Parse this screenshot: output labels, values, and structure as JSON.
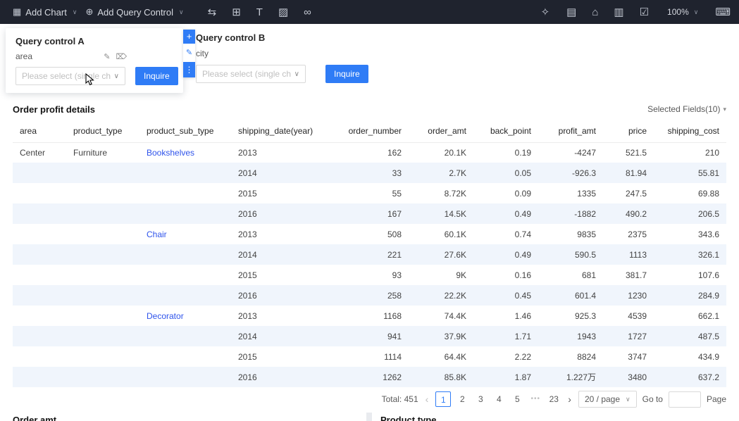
{
  "topbar": {
    "add_chart_label": "Add Chart",
    "add_query_control_label": "Add Query Control",
    "zoom_level": "100%"
  },
  "icons": {
    "add_chart": "▦",
    "add_query_control": "⊕",
    "swap": "⇆",
    "tabs": "⊞",
    "text": "T",
    "image": "▨",
    "link": "∞",
    "theme": "✧",
    "file": "▤",
    "template": "⌂",
    "export": "▥",
    "publish": "☑",
    "keyboard": "⌨",
    "pencil": "✎",
    "trash": "⌦",
    "plus": "+",
    "dots": "⋮",
    "chevron": "∨",
    "caret": "▾",
    "prev": "‹",
    "next": "›"
  },
  "query_controls": {
    "a": {
      "title": "Query control A",
      "field": "area",
      "placeholder": "Please select (single ch...",
      "button": "Inquire"
    },
    "b": {
      "title": "Query control B",
      "field": "city",
      "placeholder": "Please select (single ch...",
      "button": "Inquire"
    }
  },
  "table": {
    "title": "Order profit details",
    "selected_fields": "Selected Fields(10)",
    "headers": [
      "area",
      "product_type",
      "product_sub_type",
      "shipping_date(year)",
      "order_number",
      "order_amt",
      "back_point",
      "profit_amt",
      "price",
      "shipping_cost"
    ],
    "rows": [
      [
        "Center",
        "Furniture",
        "Bookshelves",
        "2013",
        "162",
        "20.1K",
        "0.19",
        "-4247",
        "521.5",
        "210"
      ],
      [
        "",
        "",
        "",
        "2014",
        "33",
        "2.7K",
        "0.05",
        "-926.3",
        "81.94",
        "55.81"
      ],
      [
        "",
        "",
        "",
        "2015",
        "55",
        "8.72K",
        "0.09",
        "1335",
        "247.5",
        "69.88"
      ],
      [
        "",
        "",
        "",
        "2016",
        "167",
        "14.5K",
        "0.49",
        "-1882",
        "490.2",
        "206.5"
      ],
      [
        "",
        "",
        "Chair",
        "2013",
        "508",
        "60.1K",
        "0.74",
        "9835",
        "2375",
        "343.6"
      ],
      [
        "",
        "",
        "",
        "2014",
        "221",
        "27.6K",
        "0.49",
        "590.5",
        "1113",
        "326.1"
      ],
      [
        "",
        "",
        "",
        "2015",
        "93",
        "9K",
        "0.16",
        "681",
        "381.7",
        "107.6"
      ],
      [
        "",
        "",
        "",
        "2016",
        "258",
        "22.2K",
        "0.45",
        "601.4",
        "1230",
        "284.9"
      ],
      [
        "",
        "",
        "Decorator",
        "2013",
        "1168",
        "74.4K",
        "1.46",
        "925.3",
        "4539",
        "662.1"
      ],
      [
        "",
        "",
        "",
        "2014",
        "941",
        "37.9K",
        "1.71",
        "1943",
        "1727",
        "487.5"
      ],
      [
        "",
        "",
        "",
        "2015",
        "1114",
        "64.4K",
        "2.22",
        "8824",
        "3747",
        "434.9"
      ],
      [
        "",
        "",
        "",
        "2016",
        "1262",
        "85.8K",
        "1.87",
        "1.227万",
        "3480",
        "637.2"
      ]
    ]
  },
  "pagination": {
    "total": "Total: 451",
    "pages": [
      "1",
      "2",
      "3",
      "4",
      "5",
      "•••",
      "23"
    ],
    "active": "1",
    "page_size": "20 / page",
    "goto_label": "Go to",
    "page_label": "Page"
  },
  "bottom": {
    "left_title": "Order amt",
    "right_title": "Product type"
  },
  "colors": {
    "accent": "#2f7cf6",
    "link": "#2f54eb",
    "topbar": "#1f232e",
    "zebra_row": "#f0f5fc"
  }
}
